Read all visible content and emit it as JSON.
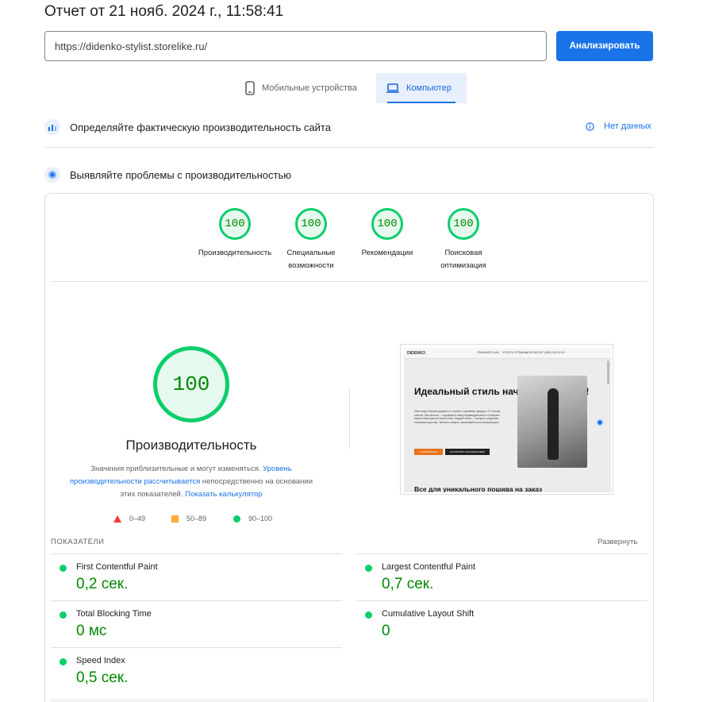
{
  "report": {
    "title": "Отчет от 21 нояб. 2024 г., 11:58:41"
  },
  "search": {
    "url": "https://didenko-stylist.storelike.ru/",
    "analyze_label": "Анализировать"
  },
  "tabs": {
    "mobile": "Мобильные устройства",
    "desktop": "Компьютер"
  },
  "field_data": {
    "title": "Определяйте фактическую производительность сайта",
    "no_data": "Нет данных"
  },
  "lab_data": {
    "title": "Выявляйте проблемы с производительностью"
  },
  "categories": [
    {
      "score": "100",
      "label": "Производительность"
    },
    {
      "score": "100",
      "label": "Специальные возможности"
    },
    {
      "score": "100",
      "label": "Рекомендации"
    },
    {
      "score": "100",
      "label": "Поисковая оптимизация"
    }
  ],
  "performance": {
    "score": "100",
    "title": "Производительность",
    "desc_1": "Значения приблизительные и могут изменяться. ",
    "desc_link_1": "Уровень производительности рассчитывается",
    "desc_2": " непосредственно на основании этих показателей. ",
    "desc_link_2": "Показать калькулятор"
  },
  "legend": {
    "fail": "0–49",
    "average": "50–89",
    "pass": "90–100"
  },
  "colors": {
    "pass": "#0cce6b",
    "average": "#ffaa33",
    "fail": "#ff3333",
    "accent": "#1a73e8",
    "pass_text": "#008800"
  },
  "screenshot": {
    "logo": "DIDENKO",
    "nav": [
      "ГЛАВНАЯ",
      "О НАС",
      "УСЛУГИ",
      "ОТЗЫВЫ",
      "КОНТАКТЫ",
      "+7 (000) 000 00 00"
    ],
    "hero_title": "Идеальный стиль начинается здесь!",
    "hero_text": "Меня зовут Наталья Диденко, я стилист и дизайнер одежды с 17-летним опытом. Моя миссия — подчеркнуть вашу индивидуальность и раскрыть внутреннюю красоту через стиль. Каждый образ — история, созданная специально для вас. Звоните, пишите, записывайтесь на консультацию.",
    "btn_primary": "▸ ЗАПИСАТЬСЯ",
    "btn_secondary": "▸ ПОЛУЧИТЬ КОНСУЛЬТАЦИЮ",
    "subtitle": "Все для уникального пошива на заказ"
  },
  "metrics": {
    "header": "ПОКАЗАТЕЛИ",
    "expand": "Развернуть",
    "items": [
      {
        "name": "First Contentful Paint",
        "value": "0,2 сек."
      },
      {
        "name": "Largest Contentful Paint",
        "value": "0,7 сек."
      },
      {
        "name": "Total Blocking Time",
        "value": "0 мс"
      },
      {
        "name": "Cumulative Layout Shift",
        "value": "0"
      },
      {
        "name": "Speed Index",
        "value": "0,5 сек."
      }
    ]
  }
}
